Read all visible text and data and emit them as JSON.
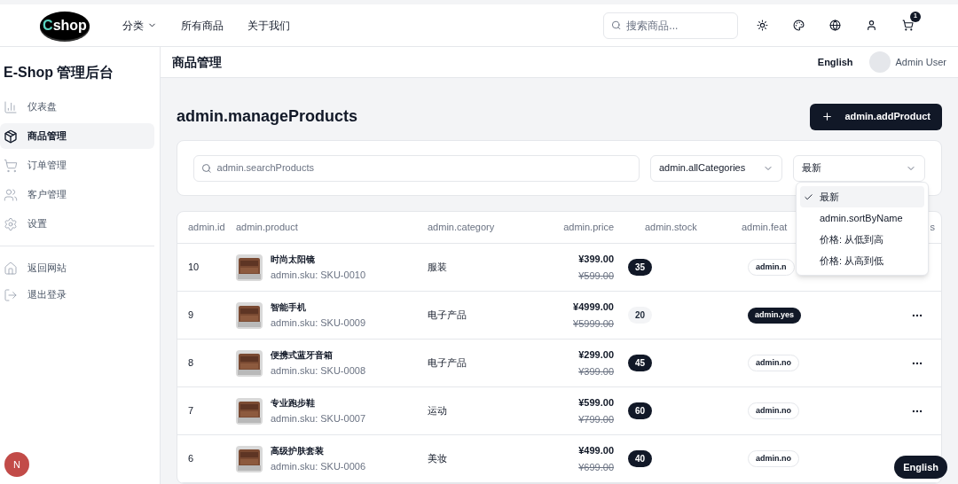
{
  "topbar": {
    "logo": {
      "mark": "C",
      "text": "shop"
    },
    "nav": [
      {
        "label": "分类",
        "dropdown": true
      },
      {
        "label": "所有商品",
        "dropdown": false
      },
      {
        "label": "关于我们",
        "dropdown": false
      }
    ],
    "search": {
      "placeholder": "搜索商品..."
    },
    "icons": [
      {
        "kind": "theme"
      },
      {
        "kind": "palette"
      },
      {
        "kind": "language"
      },
      {
        "kind": "account"
      },
      {
        "kind": "cart",
        "badge": "1"
      }
    ]
  },
  "sidebar": {
    "title": "E-Shop 管理后台",
    "items": [
      {
        "kind": "dashboard",
        "label": "仪表盘",
        "selected": false
      },
      {
        "kind": "products",
        "label": "商品管理",
        "selected": true
      },
      {
        "kind": "orders",
        "label": "订单管理",
        "selected": false
      },
      {
        "kind": "customers",
        "label": "客户管理",
        "selected": false
      },
      {
        "kind": "settings",
        "label": "设置",
        "selected": false
      }
    ],
    "footer_items": [
      {
        "kind": "home",
        "label": "返回网站"
      },
      {
        "kind": "logout",
        "label": "退出登录"
      }
    ],
    "avatar": "N"
  },
  "header": {
    "title": "商品管理",
    "language": "English",
    "user": "Admin User"
  },
  "page": {
    "title": "admin.manageProducts",
    "add_button": "admin.addProduct"
  },
  "filters": {
    "search": {
      "placeholder": "admin.searchProducts"
    },
    "category": "admin.allCategories",
    "sort": "最新",
    "sort_menu": [
      {
        "label": "最新",
        "selected": true
      },
      {
        "label": "admin.sortByName",
        "selected": false
      },
      {
        "label": "价格: 从低到高",
        "selected": false
      },
      {
        "label": "价格: 从高到低",
        "selected": false
      }
    ]
  },
  "table": {
    "columns": [
      "admin.id",
      "admin.product",
      "admin.category",
      "admin.price",
      "admin.stock",
      "admin.feat",
      "s"
    ],
    "rows": [
      {
        "id": "10",
        "name": "时尚太阳镜",
        "sku": "admin.sku: SKU-0010",
        "category": "服装",
        "price": "¥399.00",
        "old_price": "¥599.00",
        "stock": "35",
        "low_stock": false,
        "featured": false,
        "featured_label": "admin.n"
      },
      {
        "id": "9",
        "name": "智能手机",
        "sku": "admin.sku: SKU-0009",
        "category": "电子产品",
        "price": "¥4999.00",
        "old_price": "¥5999.00",
        "stock": "20",
        "low_stock": true,
        "featured": true,
        "featured_label": "admin.yes"
      },
      {
        "id": "8",
        "name": "便携式蓝牙音箱",
        "sku": "admin.sku: SKU-0008",
        "category": "电子产品",
        "price": "¥299.00",
        "old_price": "¥399.00",
        "stock": "45",
        "low_stock": false,
        "featured": false,
        "featured_label": "admin.no"
      },
      {
        "id": "7",
        "name": "专业跑步鞋",
        "sku": "admin.sku: SKU-0007",
        "category": "运动",
        "price": "¥599.00",
        "old_price": "¥799.00",
        "stock": "60",
        "low_stock": false,
        "featured": false,
        "featured_label": "admin.no"
      },
      {
        "id": "6",
        "name": "高级护肤套装",
        "sku": "admin.sku: SKU-0006",
        "category": "美妆",
        "price": "¥499.00",
        "old_price": "¥699.00",
        "stock": "40",
        "low_stock": false,
        "featured": false,
        "featured_label": "admin.no"
      }
    ]
  },
  "language_button": "English"
}
